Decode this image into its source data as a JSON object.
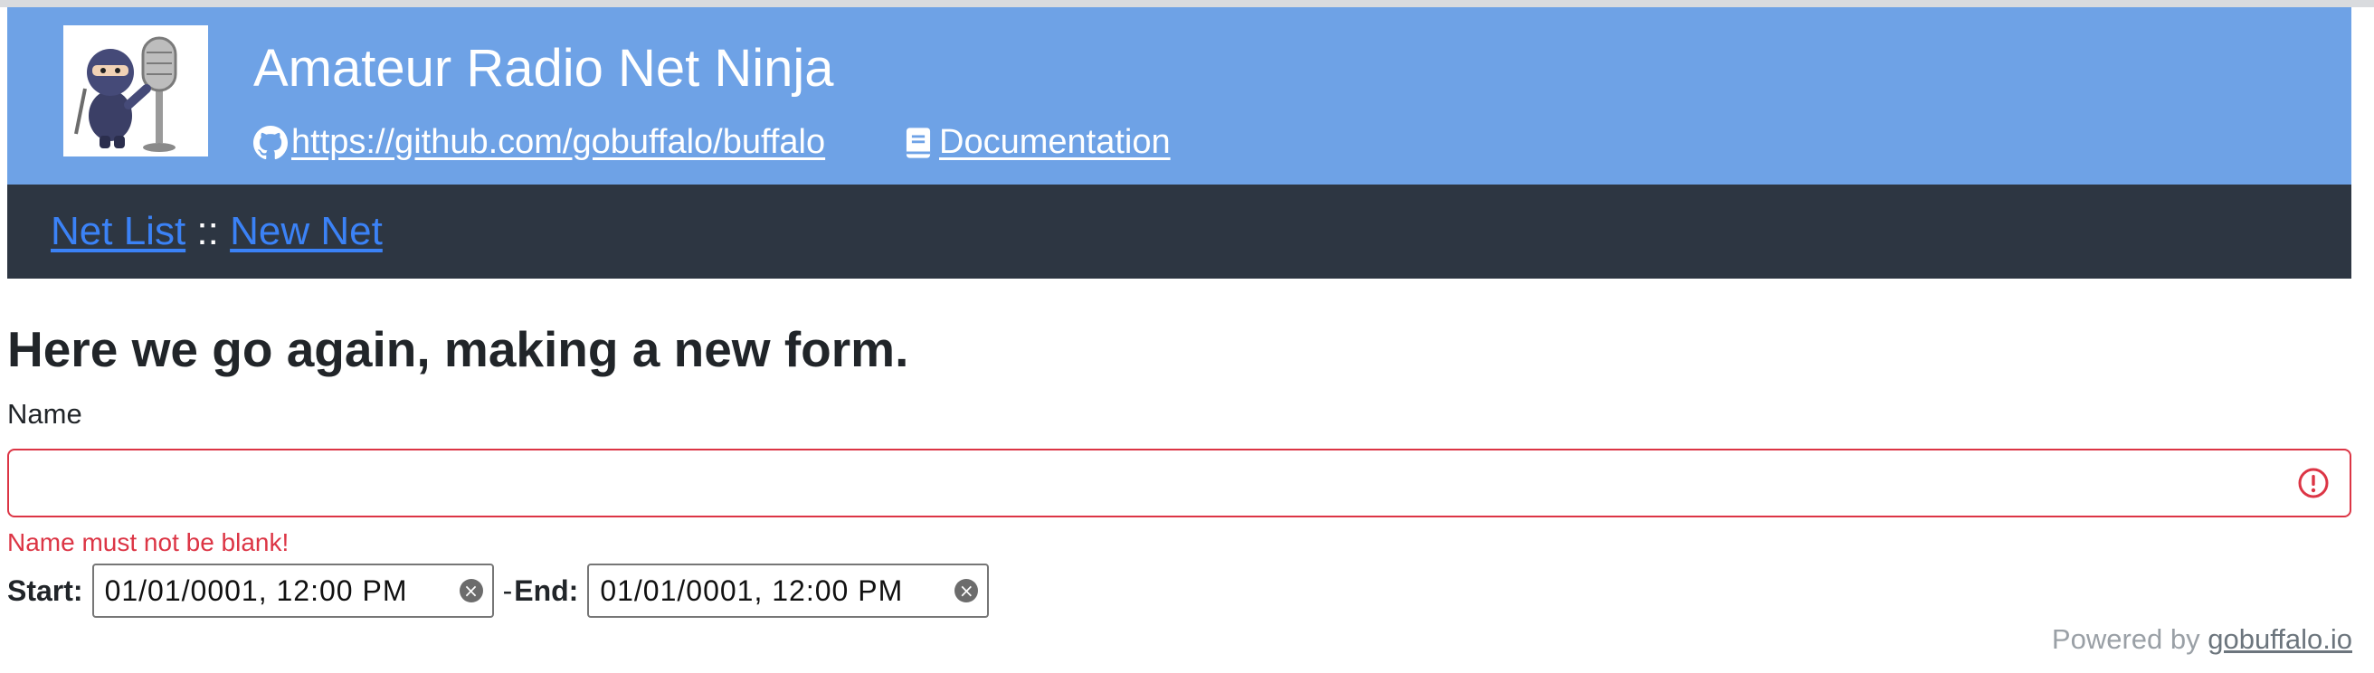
{
  "header": {
    "title": "Amateur Radio Net Ninja",
    "github_link": "https://github.com/gobuffalo/buffalo",
    "docs_link": "Documentation",
    "logo_icon": "ninja-microphone-logo",
    "github_icon": "github-icon",
    "docs_icon": "book-icon",
    "background_color": "#6ea2e6"
  },
  "nav": {
    "background_color": "#2d3642",
    "items": [
      {
        "label": "Net List"
      },
      {
        "label": "New Net"
      }
    ],
    "separator": "::"
  },
  "main": {
    "title": "Here we go again, making a new form.",
    "name_label": "Name",
    "name_value": "",
    "name_error": "Name must not be blank!",
    "start_label": "Start:",
    "start_value": "01/01/0001, 12:00 PM",
    "range_separator": "- ",
    "end_label": "End:",
    "end_value": "01/01/0001, 12:00 PM",
    "error_color": "#dc3545"
  },
  "footer": {
    "prefix": "Powered by ",
    "link": "gobuffalo.io"
  }
}
